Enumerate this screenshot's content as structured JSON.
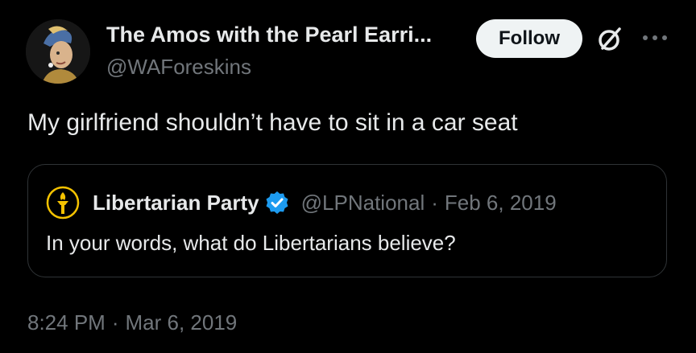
{
  "author": {
    "display_name": "The Amos with the Pearl Earri...",
    "handle": "@WAForeskins",
    "avatar_icon": "pearl-earring-portrait-avatar"
  },
  "actions": {
    "follow_label": "Follow",
    "grok_icon": "slashed-circle-icon",
    "more_icon": "more-dots-icon"
  },
  "tweet": {
    "text": "My girlfriend shouldn’t have to sit in a car seat"
  },
  "quoted": {
    "name": "Libertarian Party",
    "handle": "@LPNational",
    "separator": "·",
    "date": "Feb 6, 2019",
    "text": "In your words, what do Libertarians believe?",
    "avatar_icon": "torch-logo-icon",
    "verified_icon": "verified-badge-icon"
  },
  "timestamp": {
    "time": "8:24 PM",
    "separator": "·",
    "date": "Mar 6, 2019"
  },
  "colors": {
    "background": "#000000",
    "text_primary": "#e7e9ea",
    "text_secondary": "#71767b",
    "verified_blue": "#1d9bf0",
    "torch_yellow": "#f4c200",
    "border": "#2f3336"
  }
}
